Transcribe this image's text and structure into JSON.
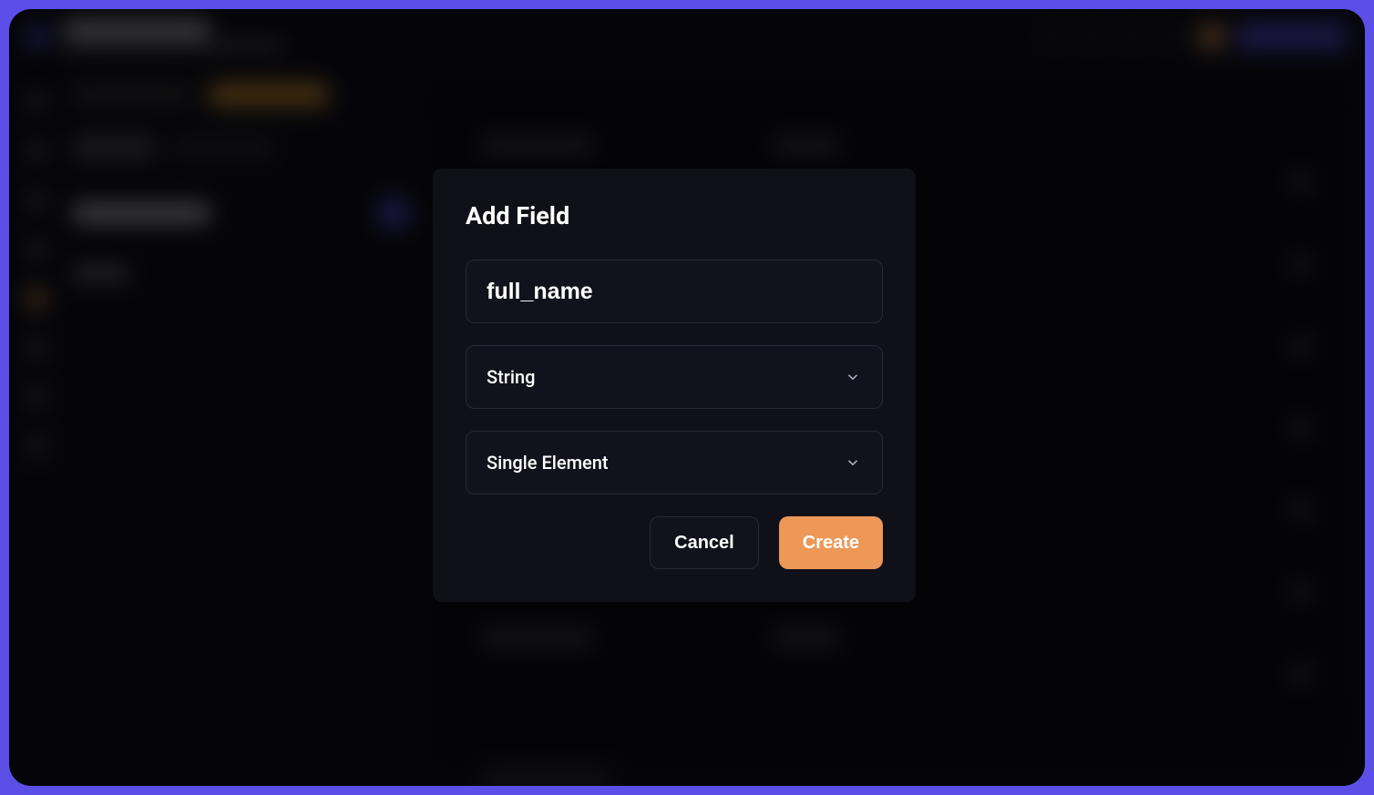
{
  "modal": {
    "title": "Add Field",
    "field_name_value": "full_name",
    "type_select": "String",
    "cardinality_select": "Single Element",
    "cancel_label": "Cancel",
    "create_label": "Create"
  },
  "colors": {
    "accent": "#5B4FE8",
    "primary_action": "#ed9857",
    "bg_dark": "#0d0d15",
    "modal_bg": "#101018",
    "input_bg": "#12121c",
    "border": "#2a2a38"
  }
}
